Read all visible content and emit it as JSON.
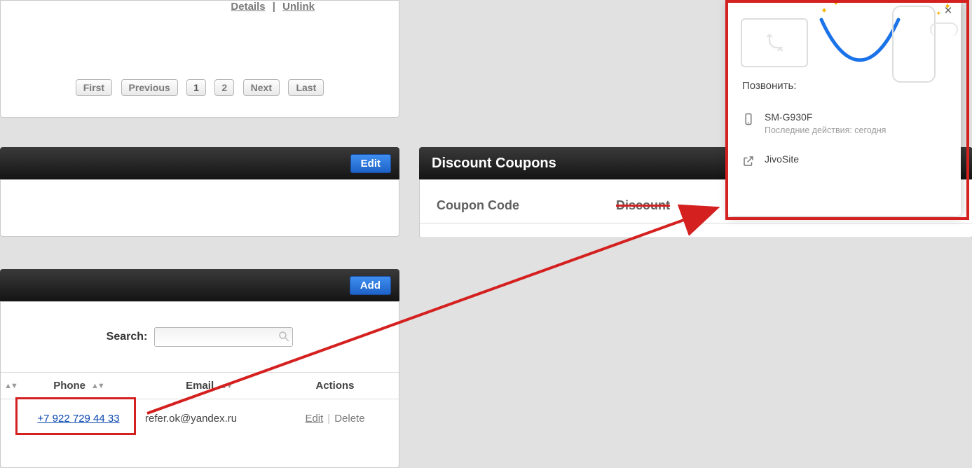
{
  "top_panel": {
    "details_link": "Details",
    "unlink_link": "Unlink",
    "pager": {
      "first": "First",
      "previous": "Previous",
      "page1": "1",
      "page2": "2",
      "next": "Next",
      "last": "Last"
    }
  },
  "edit_button": "Edit",
  "add_button": "Add",
  "search": {
    "label": "Search:",
    "value": ""
  },
  "grid": {
    "phone_header": "Phone",
    "email_header": "Email",
    "actions_header": "Actions",
    "row": {
      "phone": "+7 922 729 44 33",
      "email": "refer.ok@yandex.ru",
      "edit": "Edit",
      "delete": "Delete"
    }
  },
  "coupons": {
    "title": "Discount Coupons",
    "code_header": "Coupon Code",
    "discount_header": "Discount"
  },
  "popup": {
    "title": "Позвонить:",
    "device_name": "SM-G930F",
    "device_sub": "Последние действия: сегодня",
    "app_name": "JivoSite"
  }
}
